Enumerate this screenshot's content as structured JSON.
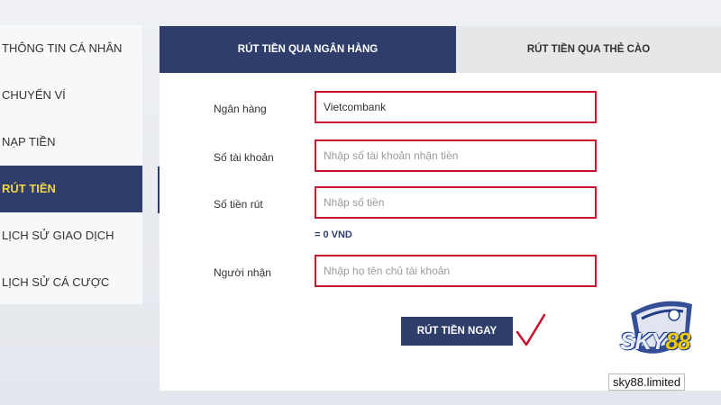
{
  "sidebar": {
    "items": [
      {
        "label": "THÔNG TIN CÁ NHÂN"
      },
      {
        "label": "CHUYỂN VÍ"
      },
      {
        "label": "NẠP TIỀN"
      },
      {
        "label": "RÚT TIỀN",
        "active": true
      },
      {
        "label": "LỊCH SỬ GIAO DỊCH"
      },
      {
        "label": "LỊCH SỬ CÁ CƯỢC"
      }
    ]
  },
  "tabs": [
    {
      "label": "RÚT TIỀN QUA NGÂN HÀNG",
      "active": true
    },
    {
      "label": "RÚT TIỀN QUA THẺ CÀO",
      "active": false
    }
  ],
  "form": {
    "bank": {
      "label": "Ngân hàng",
      "value": "Vietcombank"
    },
    "account": {
      "label": "Số tài khoản",
      "placeholder": "Nhập số tài khoản nhận tiền"
    },
    "amount": {
      "label": "Số tiền rút",
      "placeholder": "Nhập số tiền",
      "note": "= 0 VND"
    },
    "recipient": {
      "label": "Người nhận",
      "placeholder": "Nhập họ tên chủ tài khoản"
    },
    "submit_label": "RÚT TIỀN NGAY"
  },
  "branding": {
    "logo_prefix": "SKY",
    "logo_number": "88",
    "domain": "sky88.limited"
  },
  "colors": {
    "primary": "#2f3d6b",
    "accent": "#f2d54a",
    "highlight_border": "#c8102e"
  },
  "icons": {
    "check": "checkmark-icon",
    "logo": "sky88-shield-logo"
  }
}
